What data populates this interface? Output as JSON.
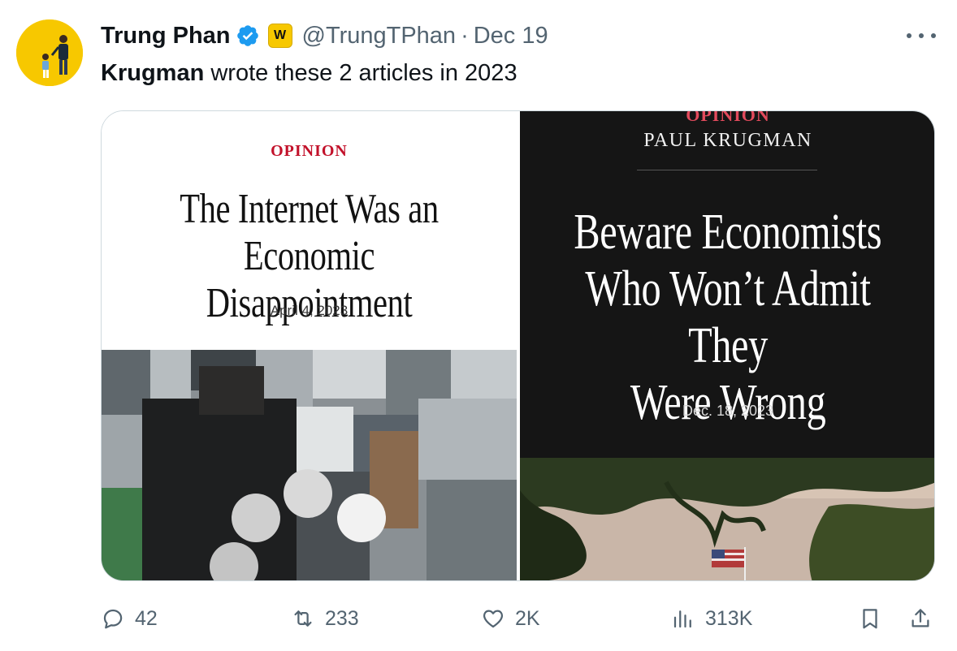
{
  "tweet": {
    "author_name": "Trung Phan",
    "handle": "@TrungTPhan",
    "separator": "·",
    "date": "Dec 19",
    "affiliate_badge": "W",
    "text_bold": "Krugman",
    "text_rest": " wrote these 2 articles in 2023"
  },
  "media": {
    "left": {
      "section": "OPINION",
      "headline_line1": "The Internet Was an Economic",
      "headline_line2": "Disappointment",
      "date": "April 4, 2023"
    },
    "right": {
      "section": "OPINION",
      "author": "PAUL KRUGMAN",
      "headline_line1": "Beware Economists",
      "headline_line2": "Who Won’t Admit They",
      "headline_line3": "Were Wrong",
      "date": "Dec. 18, 2023"
    }
  },
  "actions": {
    "replies": "42",
    "retweets": "233",
    "likes": "2K",
    "views": "313K"
  },
  "icons": {
    "avatar": "profile-avatar",
    "verified": "verified-badge-icon",
    "more": "more-options-icon",
    "reply": "reply-icon",
    "retweet": "retweet-icon",
    "like": "heart-icon",
    "views": "views-chart-icon",
    "bookmark": "bookmark-icon",
    "share": "share-icon"
  },
  "colors": {
    "accent": "#1d9bf0",
    "secondary_text": "#536471",
    "avatar_bg": "#f7c800",
    "nyt_red": "#c2112a"
  }
}
